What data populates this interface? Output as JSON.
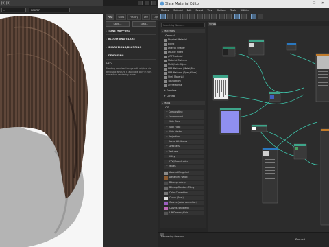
{
  "viewport": {
    "title_fragment": "[0] [R]",
    "preset_label": "...",
    "view_label": "RE6TPF"
  },
  "settings_panel": {
    "title_buttons": [
      "",
      "",
      ""
    ],
    "tabs": [
      "Post",
      "Stats",
      "History",
      "Diff",
      "Lightmix"
    ],
    "active_tab": "Post",
    "buttons": [
      "Save...",
      "Load..."
    ],
    "sections": [
      "TONE MAPPING",
      "BLOOM AND GLARE",
      "SHARPENING/BLURRING",
      "DENOISING"
    ],
    "info_title": "INFO",
    "info_text": "Blending denoised image with original via denoising amount is available only in non-interactive rendering mode"
  },
  "material_editor": {
    "title": "Slate Material Editor",
    "window_buttons": [
      "–",
      "☐",
      "✕"
    ],
    "menu": [
      "Modes",
      "Material",
      "Edit",
      "Select",
      "View",
      "Options",
      "Tools",
      "Utilities"
    ],
    "search_placeholder": "Search by Name ...",
    "view_tab": "View1",
    "browser": {
      "materials_header": "- Materials",
      "general_header": "- General",
      "general_items": [
        "Physical Material",
        "Blend",
        "DirectX Shader",
        "Double Sided",
        "glTF Material",
        "Material Switcher",
        "Multi/Sub-Object",
        "PBR Material (Metal/Rou...",
        "PBR Material (Spec/Gloss)",
        "Shell Material",
        "Top/Bottom",
        "Xref Material"
      ],
      "scanline_header": "+ Scanline",
      "corona_header": "+ Corona",
      "maps_header": "- Maps",
      "osl_header": "- OSL",
      "osl_groups": [
        "+ Compositing",
        "+ Environment",
        "+ Math Color",
        "+ Math Float",
        "+ Math Vector",
        "+ Projection",
        "+ Scene Attributes",
        "+ Switchers",
        "+ Textures",
        "+ Utility",
        "+ UVW/Coordinates",
        "+ Values"
      ],
      "map_items": [
        {
          "label": "Ascend Weighted",
          "swatch": "#8a8a8a"
        },
        {
          "label": "Advanced Wood",
          "swatch": "#8a5a30"
        },
        {
          "label": "BitmapLookup",
          "swatch": "#4a4a4a"
        },
        {
          "label": "Bitmap Random Tiling",
          "swatch": "#6b6b6b"
        },
        {
          "label": "Color Correction",
          "swatch": "#777777"
        },
        {
          "label": "Curve (float)",
          "swatch": "#dddddd"
        },
        {
          "label": "Curves (color correction)",
          "swatch": "#9b5fc0"
        },
        {
          "label": "Curves (gradient)",
          "swatch": "#c06ab8"
        },
        {
          "label": "Lift/Gamma/Gain",
          "swatch": "#555555"
        }
      ]
    },
    "status": "Rendering finished",
    "zoom_label": "Zoomed",
    "accent_color": "#7aa6d4",
    "wire_color": "#3fd0b4"
  }
}
